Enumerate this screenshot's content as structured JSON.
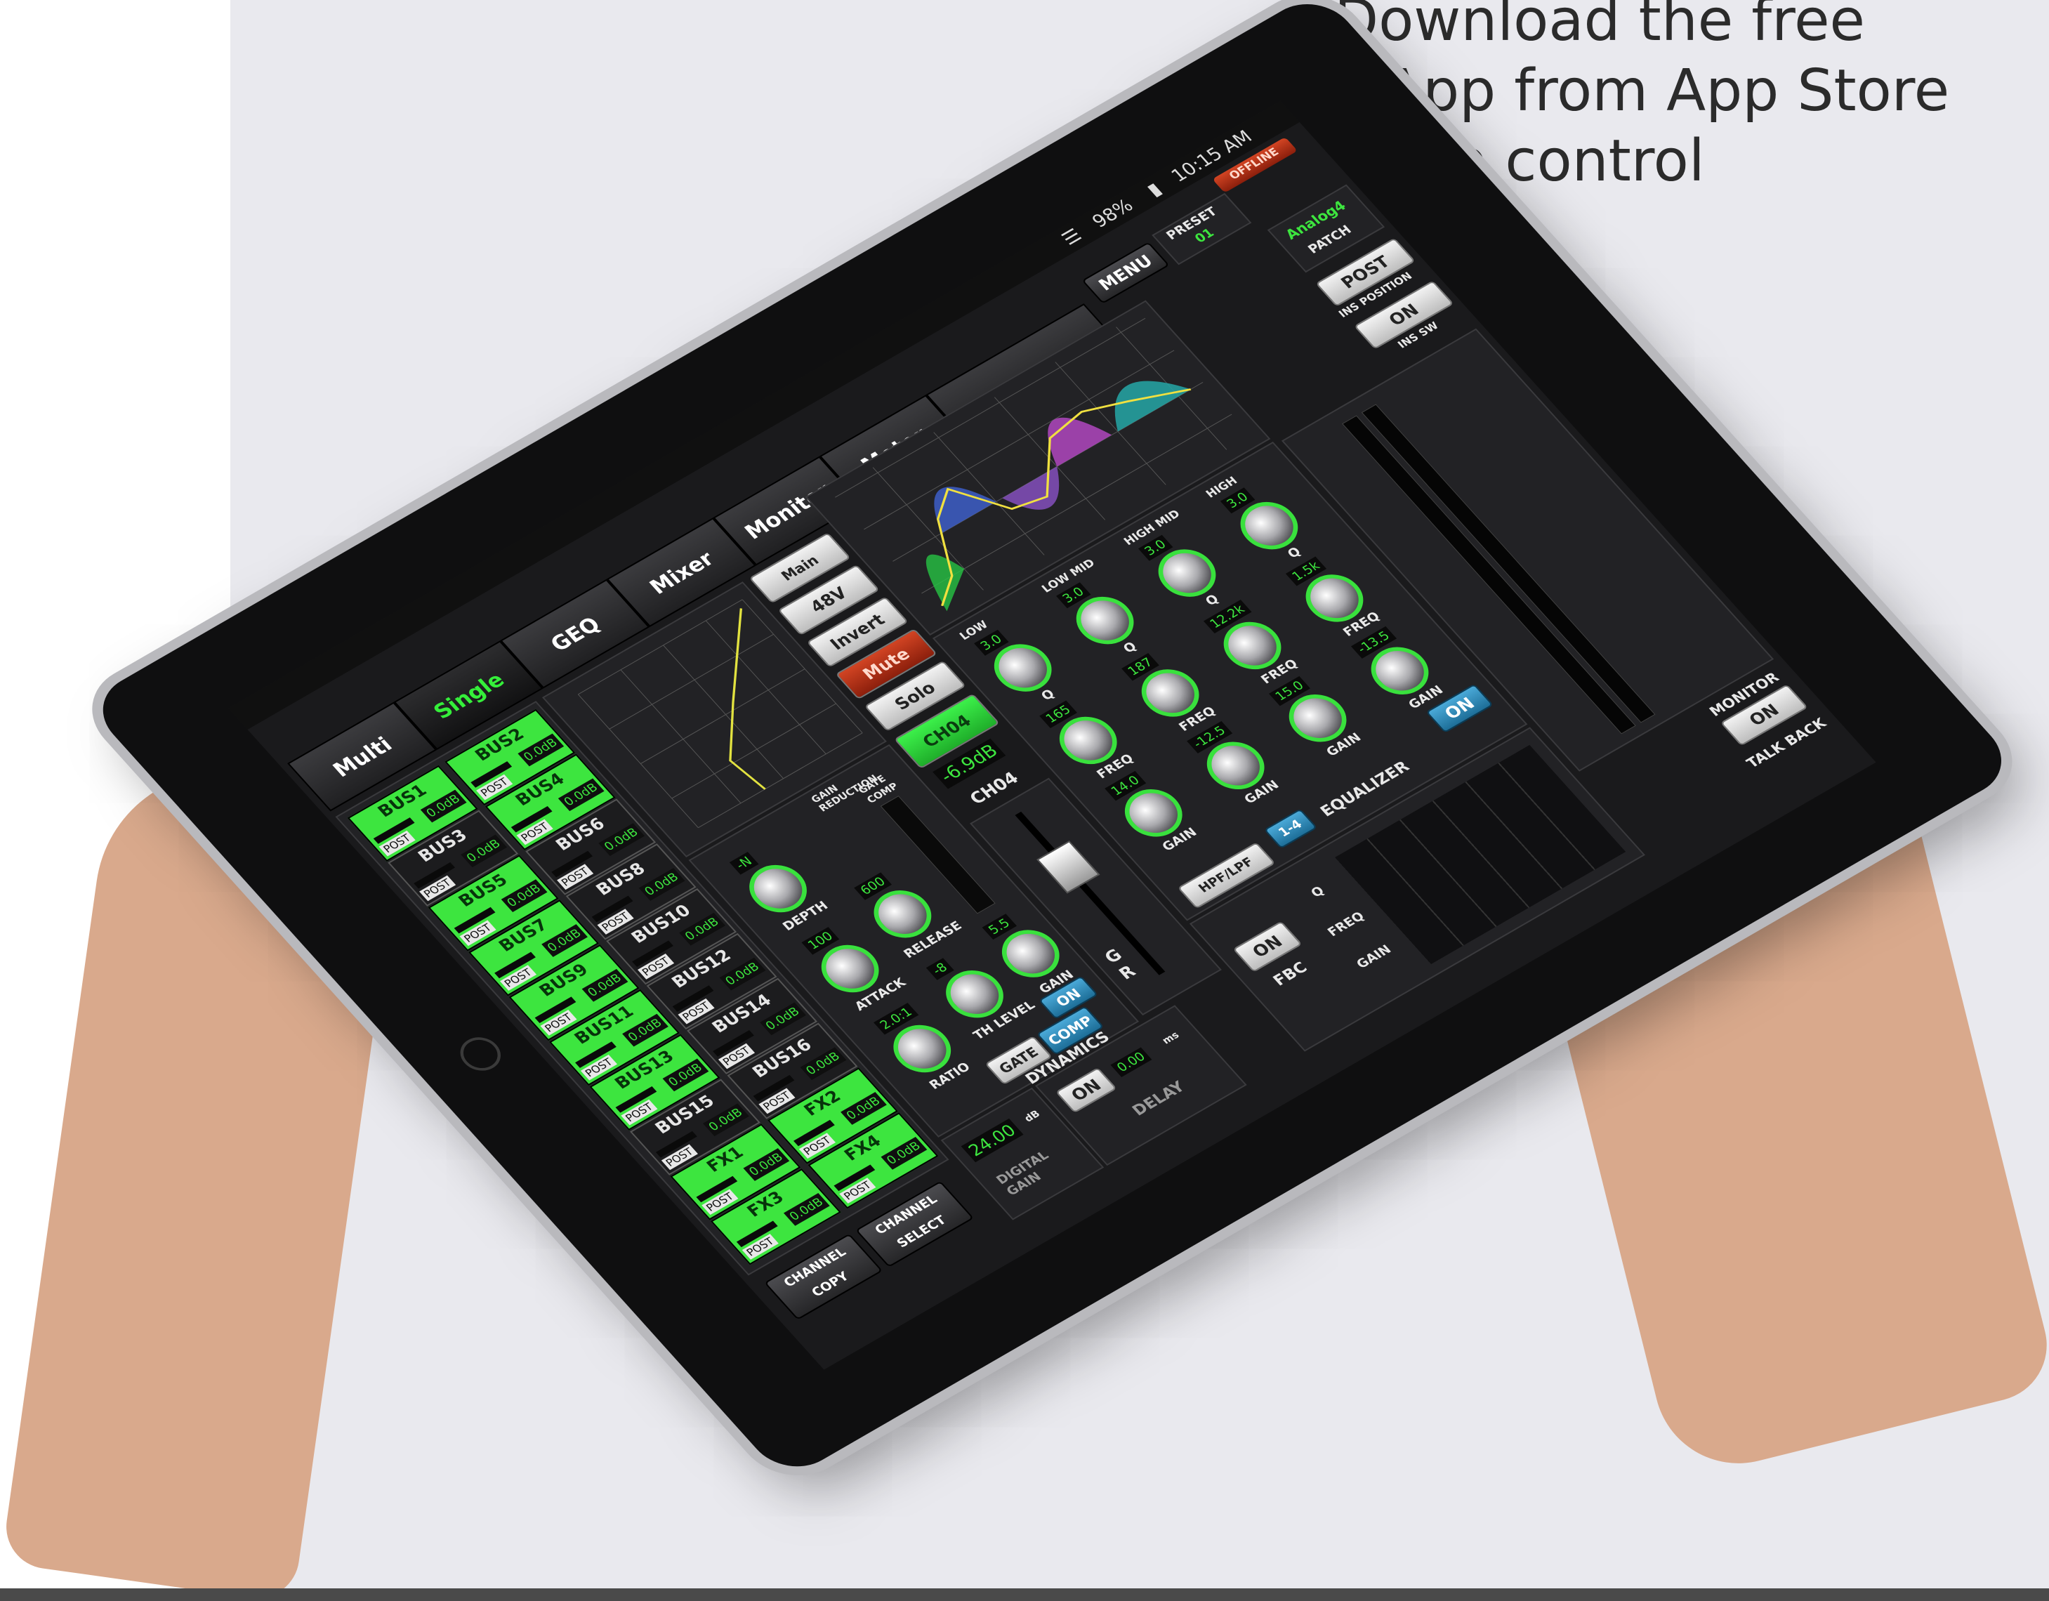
{
  "promo": {
    "line1": "Download the free",
    "line2": "App from App Store",
    "line3": "to control"
  },
  "status_bar": {
    "wifi_icon": "wifi-icon",
    "battery": "98%",
    "time": "10:15 AM",
    "offline": "OFFLINE"
  },
  "top_right": {
    "menu": "MENU",
    "preset_label": "PRESET",
    "preset_value": "01"
  },
  "tabs": [
    "Multi",
    "Single",
    "GEQ",
    "Mixer",
    "Monitor",
    "Meter"
  ],
  "active_tab": "Single",
  "patch": {
    "value": "Analog4",
    "label": "PATCH"
  },
  "ins": {
    "position_value": "POST",
    "position_label": "INS POSITION",
    "sw_value": "ON",
    "sw_label": "INS SW"
  },
  "buses": [
    {
      "name": "BUS1",
      "post": "POST",
      "gain": "0.0dB",
      "on": true
    },
    {
      "name": "BUS2",
      "post": "POST",
      "gain": "0.0dB",
      "on": true
    },
    {
      "name": "BUS3",
      "post": "POST",
      "gain": "0.0dB",
      "on": false
    },
    {
      "name": "BUS4",
      "post": "POST",
      "gain": "0.0dB",
      "on": true
    },
    {
      "name": "BUS5",
      "post": "POST",
      "gain": "0.0dB",
      "on": true
    },
    {
      "name": "BUS6",
      "post": "POST",
      "gain": "0.0dB",
      "on": false
    },
    {
      "name": "BUS7",
      "post": "POST",
      "gain": "0.0dB",
      "on": true
    },
    {
      "name": "BUS8",
      "post": "POST",
      "gain": "0.0dB",
      "on": false
    },
    {
      "name": "BUS9",
      "post": "POST",
      "gain": "0.0dB",
      "on": true
    },
    {
      "name": "BUS10",
      "post": "POST",
      "gain": "0.0dB",
      "on": false
    },
    {
      "name": "BUS11",
      "post": "POST",
      "gain": "0.0dB",
      "on": true
    },
    {
      "name": "BUS12",
      "post": "POST",
      "gain": "0.0dB",
      "on": false
    },
    {
      "name": "BUS13",
      "post": "POST",
      "gain": "0.0dB",
      "on": true
    },
    {
      "name": "BUS14",
      "post": "POST",
      "gain": "0.0dB",
      "on": false
    },
    {
      "name": "BUS15",
      "post": "POST",
      "gain": "0.0dB",
      "on": false
    },
    {
      "name": "BUS16",
      "post": "POST",
      "gain": "0.0dB",
      "on": false
    },
    {
      "name": "FX1",
      "post": "POST",
      "gain": "0.0dB",
      "on": true
    },
    {
      "name": "FX2",
      "post": "POST",
      "gain": "0.0dB",
      "on": true
    },
    {
      "name": "FX3",
      "post": "POST",
      "gain": "0.0dB",
      "on": true
    },
    {
      "name": "FX4",
      "post": "POST",
      "gain": "0.0dB",
      "on": true
    }
  ],
  "channel_buttons": {
    "copy": "CHANNEL COPY",
    "select": "CHANNEL SELECT"
  },
  "strip_buttons": {
    "main_assign": "Main Assign",
    "phantom": "48V",
    "invert": "Invert",
    "mute": "Mute",
    "solo": "Solo",
    "channel": "CH04",
    "level": "-6.9dB",
    "channel_name": "CH04"
  },
  "dynamics": {
    "title": "DYNAMICS",
    "gain_reduction": "GAIN REDUCTION",
    "gate_label": "GATE",
    "comp_label": "COMP",
    "knobs": [
      {
        "label": "DEPTH",
        "value": "-N"
      },
      {
        "label": "ATTACK",
        "value": "100"
      },
      {
        "label": "RELEASE",
        "value": "600"
      },
      {
        "label": "RATIO",
        "value": "2.0:1"
      },
      {
        "label": "TH LEVEL",
        "value": "-8"
      },
      {
        "label": "GAIN",
        "value": "5.5"
      }
    ],
    "on": "ON",
    "gate_button": "GATE",
    "comp_button": "COMP"
  },
  "digital_gain": {
    "value": "24.00",
    "unit": "dB",
    "label": "DIGITAL GAIN"
  },
  "delay": {
    "on": "ON",
    "value": "0.00",
    "unit": "ms",
    "label": "DELAY"
  },
  "fader": {
    "g_label": "G",
    "r_label": "R"
  },
  "eq": {
    "title": "EQUALIZER",
    "bands": [
      {
        "name": "LOW",
        "q": "3.0",
        "q_label": "Q",
        "freq": "165",
        "freq_label": "FREQ",
        "gain": "14.0",
        "gain_label": "GAIN"
      },
      {
        "name": "LOW MID",
        "q": "3.0",
        "q_label": "Q",
        "freq": "187",
        "freq_label": "FREQ",
        "gain": "-12.5",
        "gain_label": "GAIN"
      },
      {
        "name": "HIGH MID",
        "q": "3.0",
        "q_label": "Q",
        "freq": "12.2k",
        "freq_label": "FREQ",
        "gain": "15.0",
        "gain_label": "GAIN"
      },
      {
        "name": "HIGH",
        "q": "3.0",
        "q_label": "Q",
        "freq": "1.5k",
        "freq_label": "FREQ",
        "gain": "-13.5",
        "gain_label": "GAIN"
      }
    ],
    "on": "ON",
    "hpf_lpf": "HPF/LPF",
    "range": "1-4"
  },
  "fbc": {
    "on": "ON",
    "label": "FBC",
    "rows": [
      "Q",
      "FREQ",
      "GAIN"
    ]
  },
  "monitor": {
    "label": "MONITOR",
    "on": "ON",
    "talkback": "TALK BACK"
  },
  "colors": {
    "accent_green": "#3de53f",
    "mute_red": "#c2371a",
    "on_blue": "#2e8fc2",
    "offline_red": "#e23a2c"
  }
}
